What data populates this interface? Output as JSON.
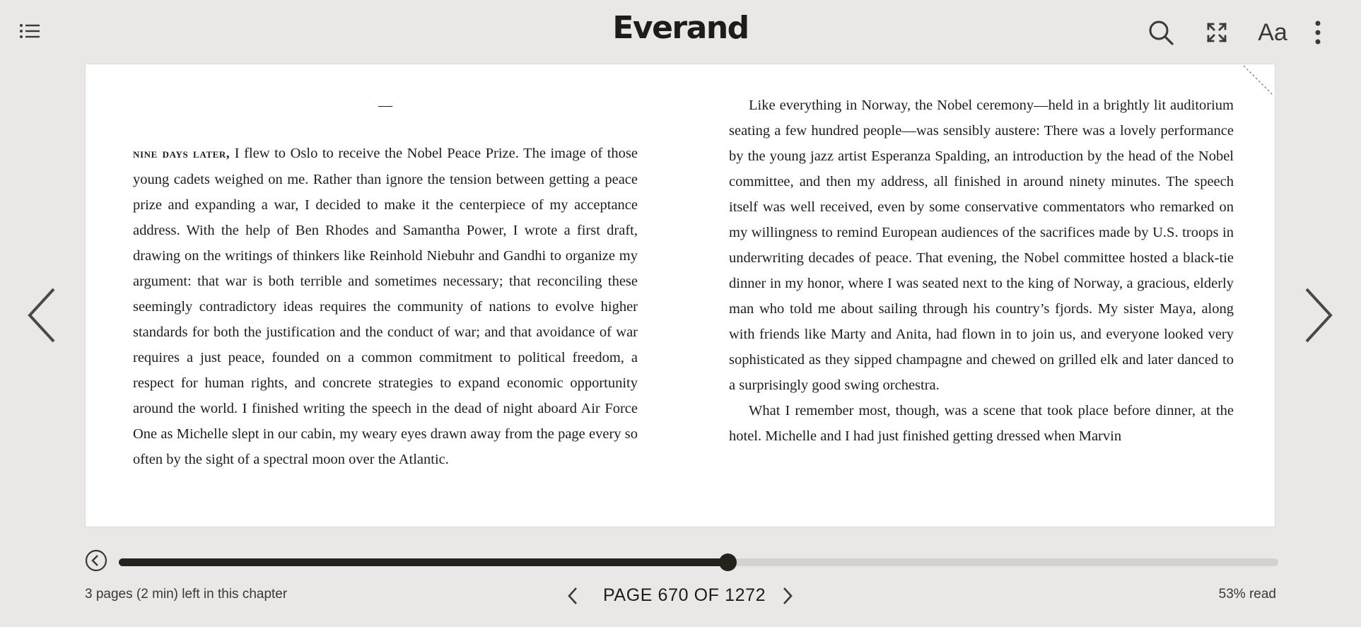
{
  "app": {
    "logo": "Everand"
  },
  "toolbar": {
    "toc_icon": "list-icon",
    "search_icon": "search-icon",
    "fullscreen_icon": "fullscreen-icon",
    "font_label": "Aa",
    "more_icon": "more-vertical-icon"
  },
  "book": {
    "left_column": {
      "separator": "—",
      "lead_smallcaps": "nine days later,",
      "paragraph": " I flew to Oslo to receive the Nobel Peace Prize. The image of those young cadets weighed on me. Rather than ignore the tension between getting a peace prize and expanding a war, I decided to make it the centerpiece of my acceptance address. With the help of Ben Rhodes and Samantha Power, I wrote a first draft, drawing on the writings of thinkers like Reinhold Niebuhr and Gandhi to organize my argument: that war is both terrible and sometimes necessary; that reconciling these seemingly contradictory ideas requires the community of nations to evolve higher standards for both the justification and the conduct of war; and that avoidance of war requires a just peace, founded on a common commitment to political freedom, a respect for human rights, and concrete strategies to expand economic opportunity around the world. I fin­ished writing the speech in the dead of night aboard Air Force One as Michelle slept in our cabin, my weary eyes drawn away from the page every so often by the sight of a spectral moon over the Atlantic."
    },
    "right_column": {
      "paragraph_1": "Like everything in Norway, the Nobel ceremony—held in a brightly lit audi­torium seating a few hundred people—was sensibly austere: There was a lovely performance by the young jazz artist Esperanza Spalding, an introduction by the head of the Nobel committee, and then my address, all finished in around ninety minutes. The speech itself was well received, even by some conservative commentators who remarked on my willingness to remind European audiences of the sacrifices made by U.S. troops in underwriting decades of peace. That evening, the Nobel committee hosted a black-tie dinner in my honor, where I was seated next to the king of Norway, a gracious, elderly man who told me about sailing through his country’s fjords. My sister Maya, along with friends like Marty and Anita, had flown in to join us, and everyone looked very sophis­ticated as they sipped champagne and chewed on grilled elk and later danced to a surprisingly good swing orchestra.",
      "paragraph_2": "What I remember most, though, was a scene that took place before dinner, at the hotel. Michelle and I had just finished getting dressed when Marvin"
    }
  },
  "navigation": {
    "prev_icon": "chevron-left-icon",
    "next_icon": "chevron-right-icon"
  },
  "footer": {
    "back_icon": "back-circle-icon",
    "chapter_remaining": "3 pages (2 min) left in this chapter",
    "page_indicator": "PAGE 670 OF 1272",
    "percent_read": "53% read",
    "progress_fraction": 0.525
  },
  "colors": {
    "background": "#e9e8e6",
    "page": "#ffffff",
    "progress_fill": "#25211c",
    "progress_track": "#d3d2cf"
  }
}
